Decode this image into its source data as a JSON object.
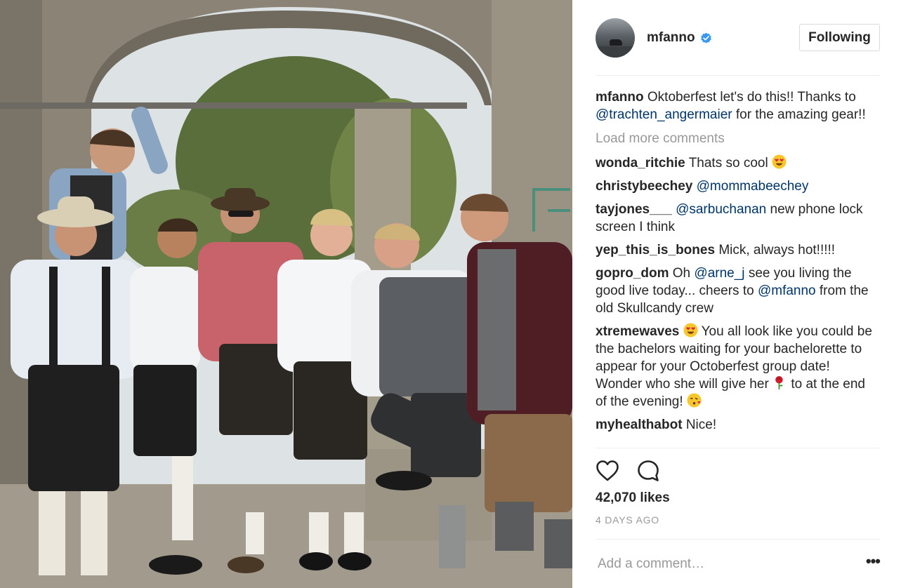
{
  "photo": {
    "description_icon": "group-photo"
  },
  "header": {
    "username": "mfanno",
    "verified_icon": "verified-badge-icon",
    "follow_label": "Following"
  },
  "caption": {
    "username": "mfanno",
    "text_before": "Oktoberfest let's do this!! Thanks to",
    "mention": "@trachten_angermaier",
    "text_after": "for the amazing gear!!"
  },
  "load_more": "Load more comments",
  "comments": [
    {
      "username": "wonda_ritchie",
      "text": "Thats so cool",
      "emoji": "heart-eyes"
    },
    {
      "username": "christybeechey",
      "mention": "@mommabeechey",
      "text": ""
    },
    {
      "username": "tayjones___",
      "mention": "@sarbuchanan",
      "text": "new phone lock screen I think"
    },
    {
      "username": "yep_this_is_bones",
      "text": "Mick, always hot!!!!!"
    },
    {
      "username": "gopro_dom",
      "text_1": "Oh",
      "mention_1": "@arne_j",
      "text_2": "see you living the good live today... cheers to",
      "mention_2": "@mfanno",
      "text_3": "from the old Skullcandy crew"
    },
    {
      "username": "xtremewaves",
      "text_1": "You all look like you could be the bachelors waiting for your bachelorette to appear for your Octoberfest group date! Wonder who she will give her",
      "text_2": "to at the end of the evening!"
    },
    {
      "username": "myhealthabot",
      "text": "Nice!"
    }
  ],
  "actions": {
    "like_icon": "heart-icon",
    "comment_icon": "speech-bubble-icon",
    "likes": "42,070 likes",
    "time_ago": "4 DAYS AGO"
  },
  "add_comment": {
    "placeholder": "Add a comment…",
    "more_label": "•••"
  },
  "colors": {
    "mention": "#003569",
    "muted": "#999999",
    "verified": "#3897f0",
    "text": "#262626"
  }
}
